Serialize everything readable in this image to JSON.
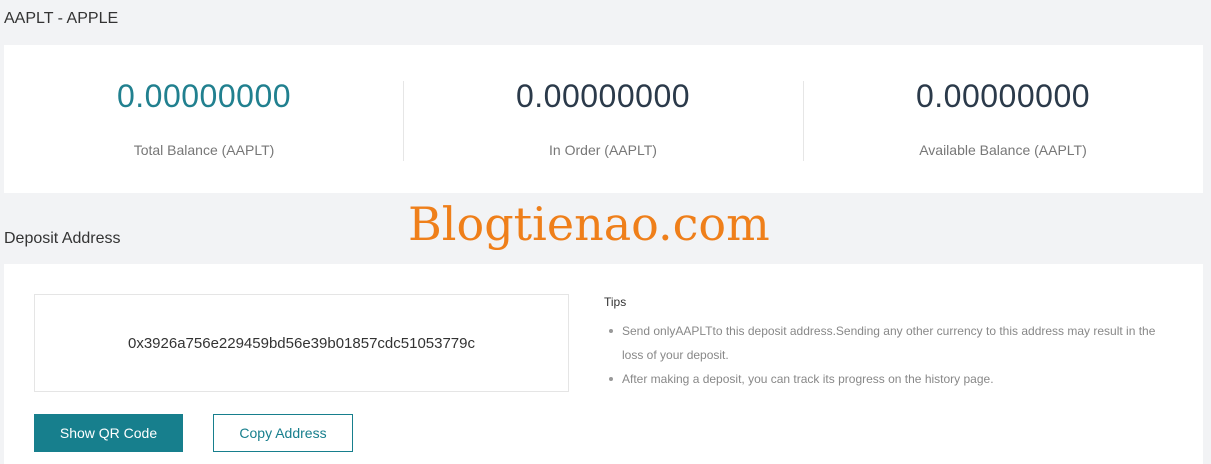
{
  "page": {
    "title": "AAPLT - APPLE"
  },
  "balances": [
    {
      "value": "0.00000000",
      "label": "Total Balance (AAPLT)"
    },
    {
      "value": "0.00000000",
      "label": "In Order (AAPLT)"
    },
    {
      "value": "0.00000000",
      "label": "Available Balance (AAPLT)"
    }
  ],
  "watermark": "Blogtienao.com",
  "deposit": {
    "title": "Deposit Address",
    "address": "0x3926a756e229459bd56e39b01857cdc51053779c",
    "show_qr_label": "Show QR Code",
    "copy_label": "Copy Address",
    "tips_title": "Tips",
    "tips": [
      "Send onlyAAPLTto this deposit address.Sending any other currency to this address may result in the loss of your deposit.",
      "After making a deposit, you can track its progress on the history page."
    ]
  },
  "colors": {
    "accent": "#177f8d",
    "accent_text": "#21808f",
    "watermark": "#ef7f1a",
    "background": "#f2f3f5"
  }
}
